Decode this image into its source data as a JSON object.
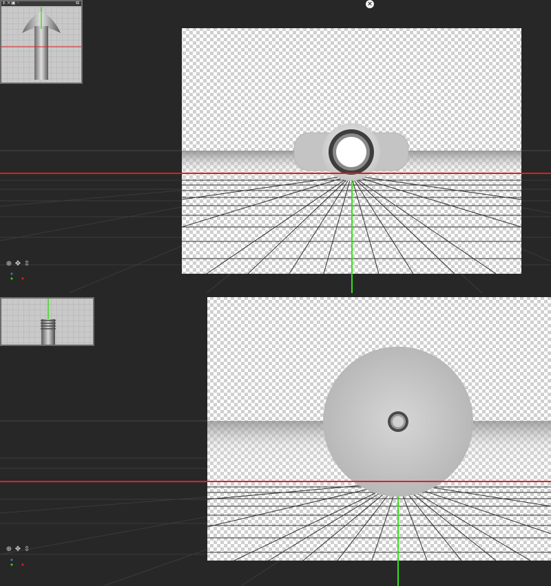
{
  "app": {
    "close_glyph": "×"
  },
  "top_view": {
    "minimap": {
      "bar_left": "‡ ×",
      "bar_mid": "▣ -",
      "bar_right": "⧉"
    },
    "nav_icons": [
      "orbit-icon",
      "pan-icon",
      "dolly-icon"
    ],
    "nav_glyphs": [
      "⊕",
      "✥",
      "⇳"
    ]
  },
  "bottom_view": {
    "nav_icons": [
      "orbit-icon",
      "pan-icon",
      "dolly-icon"
    ],
    "nav_glyphs": [
      "⊕",
      "✥",
      "⇳"
    ]
  },
  "colors": {
    "background": "#272727",
    "ground_axis": "#e0201a",
    "vertical_axis": "#3adf1a",
    "grid": "#3c3c3c"
  }
}
